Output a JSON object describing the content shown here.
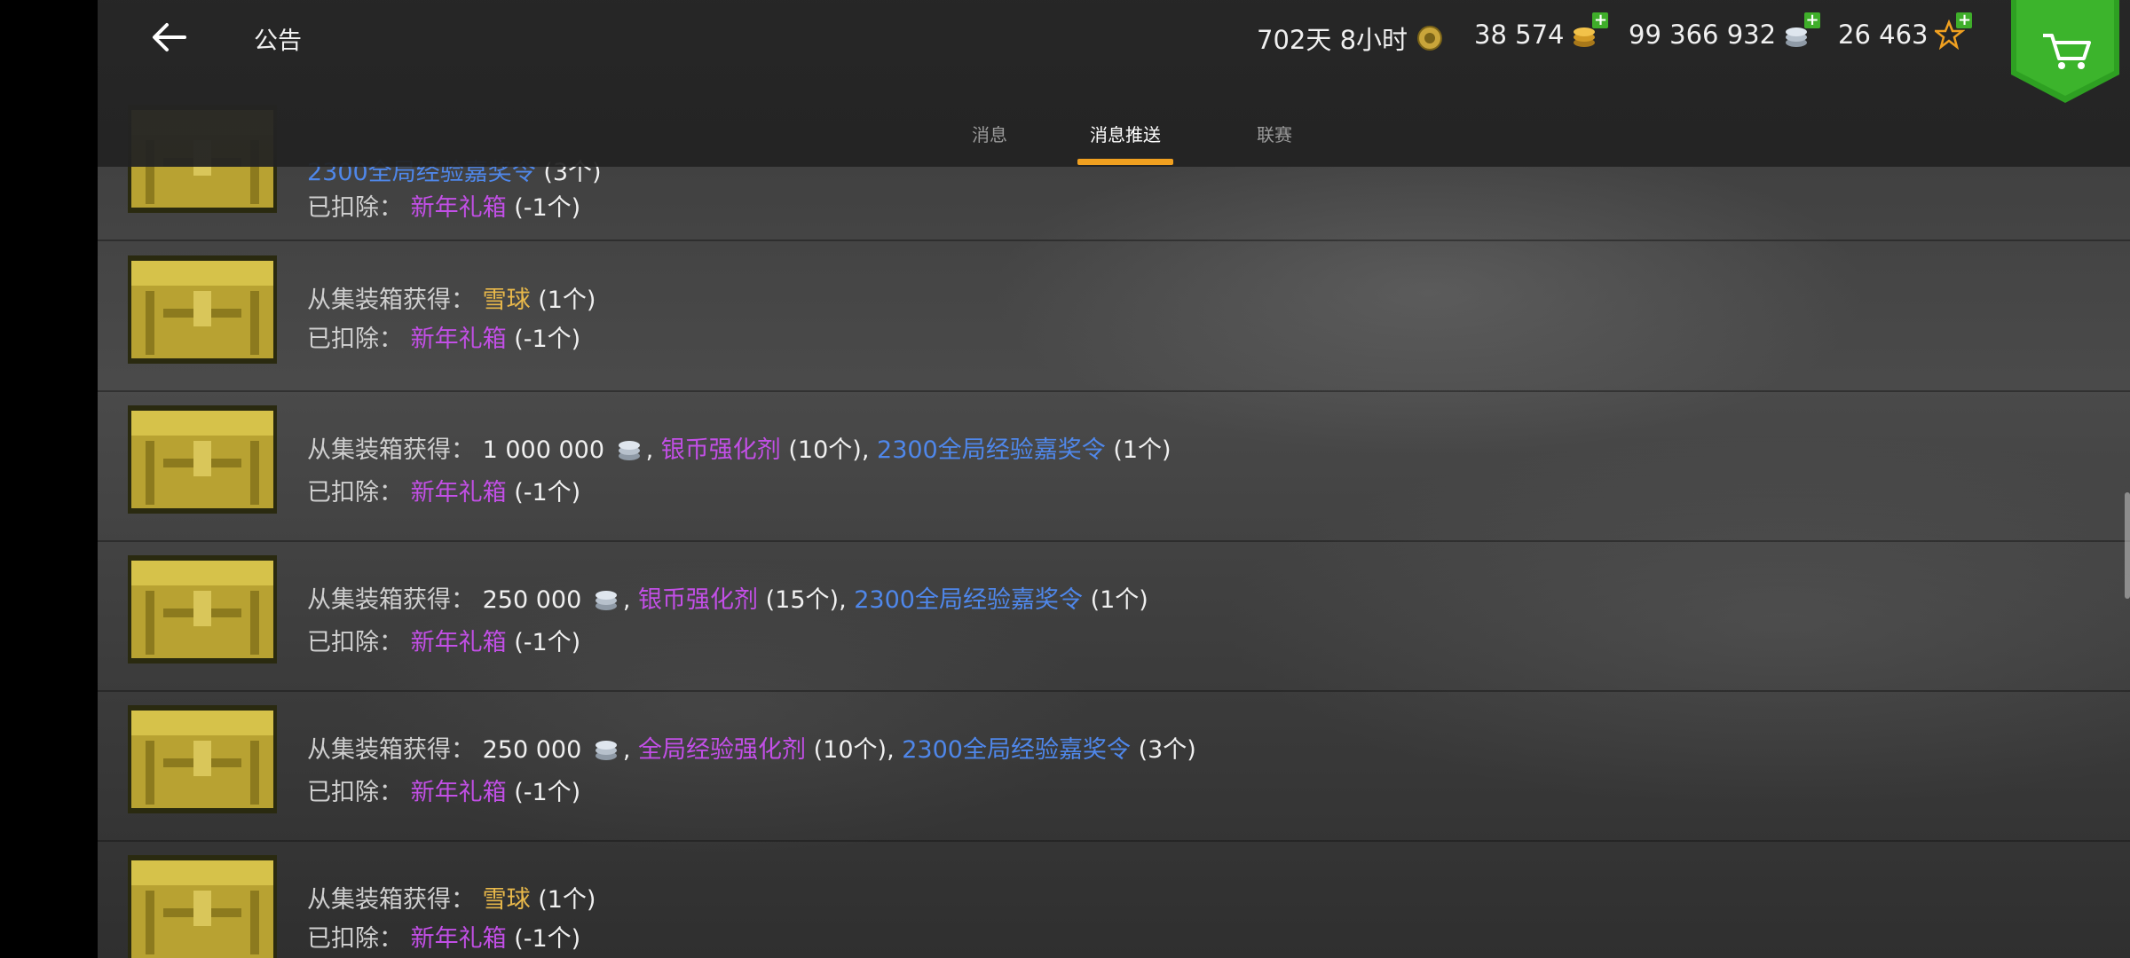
{
  "header": {
    "title": "公告",
    "timer": "702天 8小时",
    "gold": "38 574",
    "silver": "99 366 932",
    "free_xp": "26 463"
  },
  "tabs": [
    {
      "label": "消息"
    },
    {
      "label": "消息推送"
    },
    {
      "label": "联赛"
    }
  ],
  "active_tab": "消息推送",
  "colors": {
    "accent": "#f0a020",
    "item_gold": "#e8b84a",
    "item_purple": "#c24fe6",
    "item_blue": "#4f87ea",
    "cart_green": "#2ea022"
  },
  "icons": {
    "back": "arrow-left-icon",
    "timer": "premium-badge-icon",
    "gold": "gold-coin-icon",
    "silver": "silver-coin-icon",
    "free_xp": "star-icon",
    "cart": "cart-icon",
    "chest": "crate-icon"
  },
  "rows": [
    {
      "line1_text": "2300全局经验嘉奖令",
      "line1_count": "(3个)",
      "deduct_label": "已扣除：",
      "deduct_item": "新年礼箱",
      "deduct_count": "(-1个)"
    },
    {
      "obtain_label": "从集装箱获得：",
      "item1": "雪球",
      "count1": "(1个)",
      "deduct_label": "已扣除：",
      "deduct_item": "新年礼箱",
      "deduct_count": "(-1个)"
    },
    {
      "obtain_label": "从集装箱获得：",
      "silver_amount": "1 000 000",
      "item1": "银币强化剂",
      "count1": "(10个)",
      "item2": "2300全局经验嘉奖令",
      "count2": "(1个)",
      "deduct_label": "已扣除：",
      "deduct_item": "新年礼箱",
      "deduct_count": "(-1个)"
    },
    {
      "obtain_label": "从集装箱获得：",
      "silver_amount": "250 000",
      "item1": "银币强化剂",
      "count1": "(15个)",
      "item2": "2300全局经验嘉奖令",
      "count2": "(1个)",
      "deduct_label": "已扣除：",
      "deduct_item": "新年礼箱",
      "deduct_count": "(-1个)"
    },
    {
      "obtain_label": "从集装箱获得：",
      "silver_amount": "250 000",
      "item1": "全局经验强化剂",
      "count1": "(10个)",
      "item2": "2300全局经验嘉奖令",
      "count2": "(3个)",
      "deduct_label": "已扣除：",
      "deduct_item": "新年礼箱",
      "deduct_count": "(-1个)"
    },
    {
      "obtain_label": "从集装箱获得：",
      "item1": "雪球",
      "count1": "(1个)",
      "deduct_label": "已扣除：",
      "deduct_item": "新年礼箱",
      "deduct_count": "(-1个)"
    }
  ]
}
